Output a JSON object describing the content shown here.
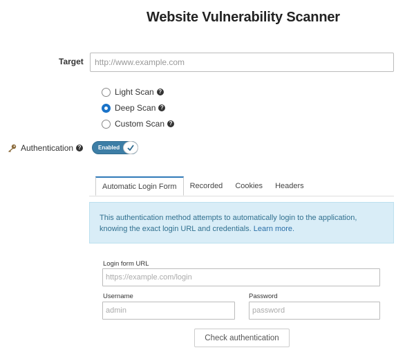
{
  "title": "Website Vulnerability Scanner",
  "target": {
    "label": "Target",
    "placeholder": "http://www.example.com"
  },
  "scan_types": [
    {
      "label": "Light Scan",
      "checked": false
    },
    {
      "label": "Deep Scan",
      "checked": true
    },
    {
      "label": "Custom Scan",
      "checked": false
    }
  ],
  "help_glyph": "?",
  "authentication": {
    "label": "Authentication",
    "toggle_label": "Enabled",
    "enabled": true
  },
  "tabs": [
    {
      "label": "Automatic Login Form",
      "active": true
    },
    {
      "label": "Recorded",
      "active": false
    },
    {
      "label": "Cookies",
      "active": false
    },
    {
      "label": "Headers",
      "active": false
    }
  ],
  "info": {
    "text": "This authentication method attempts to automatically login to the application, knowing the exact login URL and credentials.",
    "link": "Learn more."
  },
  "form": {
    "login_url": {
      "label": "Login form URL",
      "placeholder": "https://example.com/login"
    },
    "username": {
      "label": "Username",
      "placeholder": "admin"
    },
    "password": {
      "label": "Password",
      "placeholder": "password"
    },
    "check_button": "Check authentication"
  },
  "colors": {
    "accent": "#2f7ab8",
    "toggle": "#3d7ea6",
    "info_bg": "#d9edf7",
    "info_text": "#31708f"
  }
}
